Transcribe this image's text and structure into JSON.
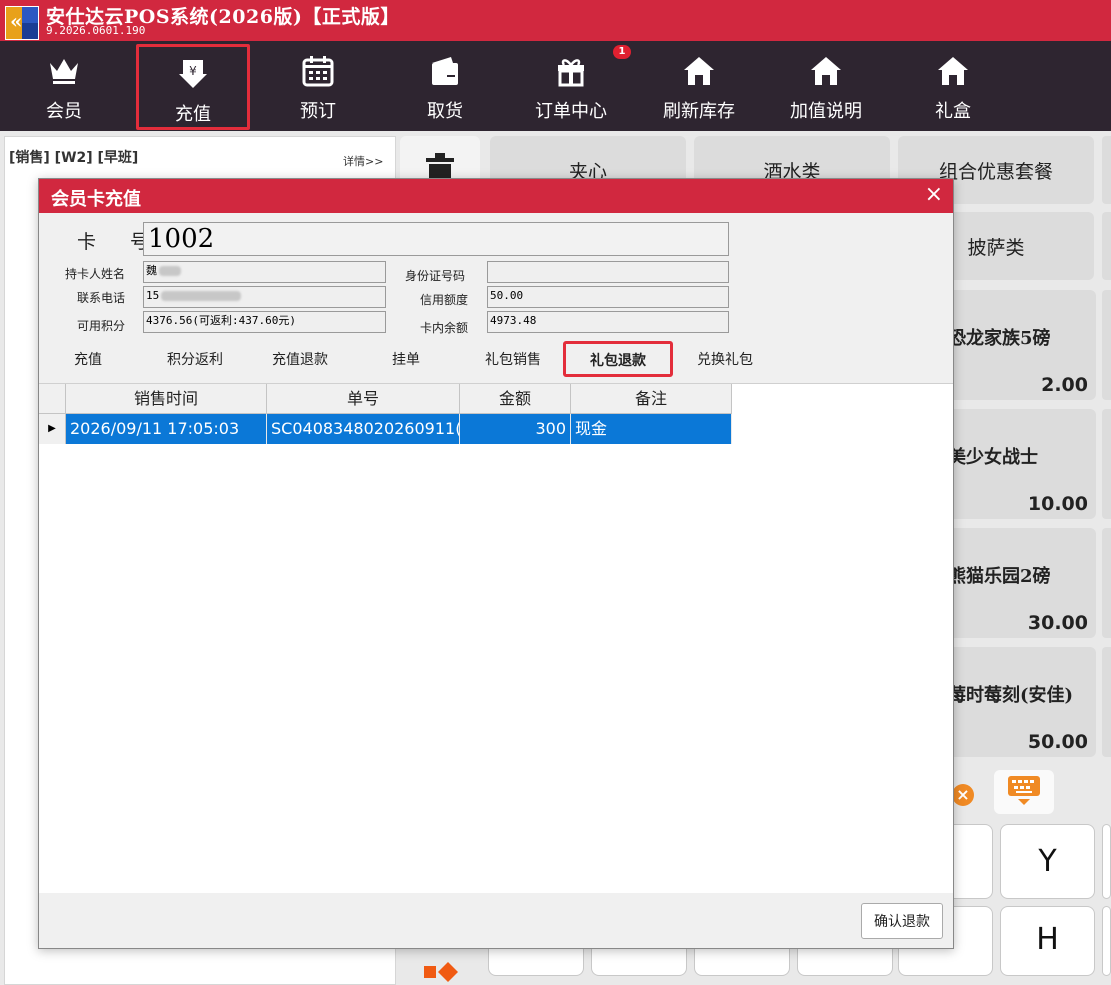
{
  "app": {
    "title": "安仕达云POS系统(2026版)【正式版】",
    "version": "9.2026.0601.190"
  },
  "toolbar": {
    "items": [
      {
        "label": "会员",
        "icon": "crown-icon"
      },
      {
        "label": "充值",
        "icon": "yuan-down-icon"
      },
      {
        "label": "预订",
        "icon": "calendar-icon"
      },
      {
        "label": "取货",
        "icon": "wallet-icon"
      },
      {
        "label": "订单中心",
        "icon": "gift-icon",
        "badge": "1"
      },
      {
        "label": "刷新库存",
        "icon": "home-icon"
      },
      {
        "label": "加值说明",
        "icon": "home-icon"
      },
      {
        "label": "礼盒",
        "icon": "home-icon"
      }
    ],
    "active": "充值"
  },
  "left_panel": {
    "shift": "[销售] [W2] [早班]",
    "details": "详情>>"
  },
  "categories": [
    "夹心",
    "酒水类",
    "组合优惠套餐",
    "披萨类"
  ],
  "products": [
    {
      "name": "恐龙家族5磅",
      "price": "2.00"
    },
    {
      "name": "美少女战士",
      "price": "10.00"
    },
    {
      "name": "熊猫乐园2磅",
      "price": "30.00"
    },
    {
      "name": "莓时莓刻(安佳)",
      "price": "50.00"
    }
  ],
  "keys": [
    "Y",
    "H"
  ],
  "dialog": {
    "title": "会员卡充值",
    "close": "×",
    "card_label": "卡 号",
    "card_no": "1002",
    "holder_label": "持卡人姓名",
    "holder_value": "魏",
    "id_label": "身份证号码",
    "id_value": "",
    "phone_label": "联系电话",
    "phone_value": "15",
    "credit_label": "信用额度",
    "credit_value": "50.00",
    "points_label": "可用积分",
    "points_value": "4376.56(可返利:437.60元)",
    "balance_label": "卡内余额",
    "balance_value": "4973.48",
    "tabs": [
      "充值",
      "积分返利",
      "充值退款",
      "挂单",
      "礼包销售",
      "礼包退款",
      "兑换礼包"
    ],
    "active_tab": "礼包退款",
    "columns": [
      "销售时间",
      "单号",
      "金额",
      "备注"
    ],
    "rows": [
      {
        "time": "2026/09/11 17:05:03",
        "order_no": "SC0408348020260911(",
        "amount": "300",
        "note": "现金"
      }
    ],
    "confirm_button": "确认退款"
  }
}
